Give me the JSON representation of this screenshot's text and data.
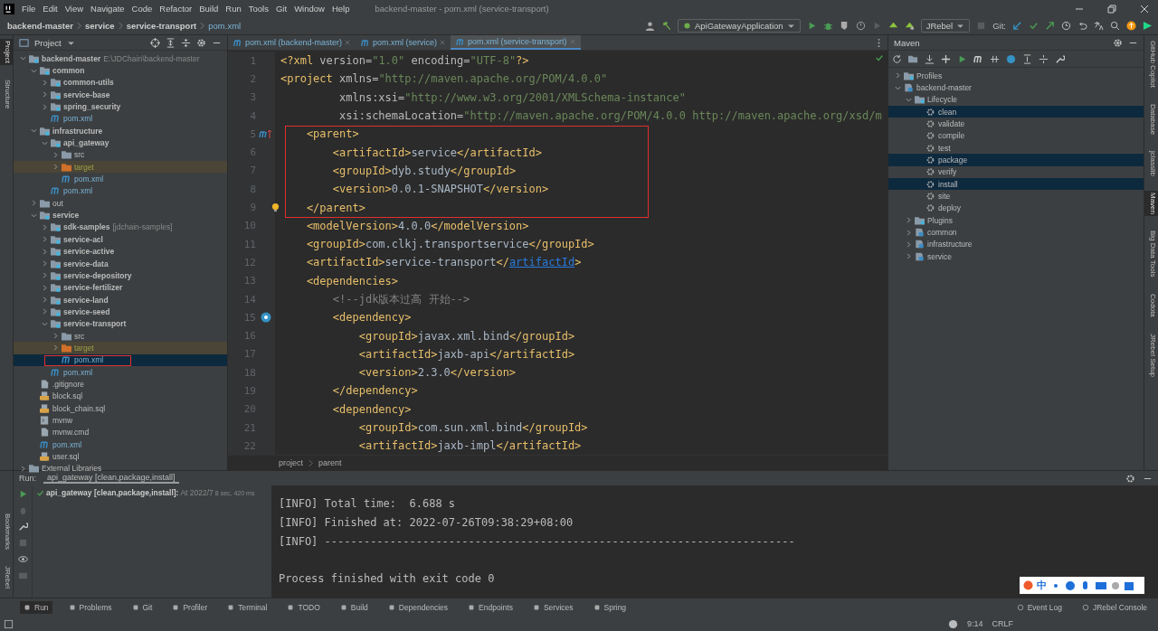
{
  "window": {
    "title": "backend-master - pom.xml (service-transport)"
  },
  "menu": [
    "File",
    "Edit",
    "View",
    "Navigate",
    "Code",
    "Refactor",
    "Build",
    "Run",
    "Tools",
    "Git",
    "Window",
    "Help"
  ],
  "breadcrumbs": [
    "backend-master",
    "service",
    "service-transport",
    "pom.xml"
  ],
  "toolbar": {
    "run_config": "ApiGatewayApplication",
    "jrebel": "JRebel",
    "git_label": "Git:"
  },
  "left_strip": [
    {
      "label": "Project",
      "selected": true
    },
    {
      "label": "Structure",
      "selected": false
    }
  ],
  "left_strip_bottom": [
    {
      "label": "Bookmarks",
      "selected": false
    },
    {
      "label": "JRebel",
      "selected": false
    }
  ],
  "right_strip": [
    {
      "label": "GitHub Copilot",
      "selected": false
    },
    {
      "label": "Database",
      "selected": false
    },
    {
      "label": "jclasslib",
      "selected": false
    },
    {
      "label": "Maven",
      "selected": true
    },
    {
      "label": "Big Data Tools",
      "selected": false
    },
    {
      "label": "Codota",
      "selected": false
    },
    {
      "label": "JRebel Setup",
      "selected": false
    }
  ],
  "project": {
    "title": "Project",
    "tree": [
      {
        "label": "backend-master",
        "note": "E:\\JDChain\\backend-master",
        "kind": "module",
        "expanded": true,
        "selected": false,
        "children": [
          {
            "label": "common",
            "kind": "module",
            "expanded": true,
            "selected": false,
            "children": [
              {
                "label": "common-utils",
                "kind": "module",
                "expanded": false,
                "selected": false
              },
              {
                "label": "service-base",
                "kind": "module",
                "expanded": false,
                "selected": false
              },
              {
                "label": "spring_security",
                "kind": "module",
                "expanded": false,
                "selected": false
              },
              {
                "label": "pom.xml",
                "kind": "maven",
                "selected": false
              }
            ]
          },
          {
            "label": "infrastructure",
            "kind": "module",
            "expanded": true,
            "selected": false,
            "children": [
              {
                "label": "api_gateway",
                "kind": "module",
                "expanded": true,
                "selected": false,
                "children": [
                  {
                    "label": "src",
                    "kind": "folder",
                    "expanded": false,
                    "selected": false
                  },
                  {
                    "label": "target",
                    "kind": "target",
                    "expanded": false,
                    "selected": false
                  },
                  {
                    "label": "pom.xml",
                    "kind": "maven",
                    "selected": false
                  }
                ]
              },
              {
                "label": "pom.xml",
                "kind": "maven",
                "selected": false
              }
            ]
          },
          {
            "label": "out",
            "kind": "folder",
            "expanded": false,
            "selected": false
          },
          {
            "label": "service",
            "kind": "module",
            "expanded": true,
            "selected": false,
            "children": [
              {
                "label": "sdk-samples",
                "note": "[jdchain-samples]",
                "kind": "module",
                "expanded": false,
                "selected": false
              },
              {
                "label": "service-acl",
                "kind": "module",
                "expanded": false,
                "selected": false
              },
              {
                "label": "service-active",
                "kind": "module",
                "expanded": false,
                "selected": false
              },
              {
                "label": "service-data",
                "kind": "module",
                "expanded": false,
                "selected": false
              },
              {
                "label": "service-depository",
                "kind": "module",
                "expanded": false,
                "selected": false
              },
              {
                "label": "service-fertilizer",
                "kind": "module",
                "expanded": false,
                "selected": false
              },
              {
                "label": "service-land",
                "kind": "module",
                "expanded": false,
                "selected": false
              },
              {
                "label": "service-seed",
                "kind": "module",
                "expanded": false,
                "selected": false
              },
              {
                "label": "service-transport",
                "kind": "module",
                "expanded": true,
                "selected": false,
                "children": [
                  {
                    "label": "src",
                    "kind": "folder",
                    "expanded": false,
                    "selected": false
                  },
                  {
                    "label": "target",
                    "kind": "target",
                    "expanded": false,
                    "selected": false
                  },
                  {
                    "label": "pom.xml",
                    "kind": "maven",
                    "selected": true
                  }
                ]
              },
              {
                "label": "pom.xml",
                "kind": "maven",
                "selected": false
              }
            ]
          },
          {
            "label": ".gitignore",
            "kind": "file",
            "selected": false
          },
          {
            "label": "block.sql",
            "kind": "sql",
            "selected": false
          },
          {
            "label": "block_chain.sql",
            "kind": "sql",
            "selected": false
          },
          {
            "label": "mvnw",
            "kind": "script",
            "selected": false
          },
          {
            "label": "mvnw.cmd",
            "kind": "file",
            "selected": false
          },
          {
            "label": "pom.xml",
            "kind": "maven",
            "selected": false
          },
          {
            "label": "user.sql",
            "kind": "sql",
            "selected": false
          }
        ]
      },
      {
        "label": "External Libraries",
        "kind": "library",
        "expanded": false,
        "selected": false
      }
    ]
  },
  "editor": {
    "tabs": [
      {
        "label": "pom.xml (backend-master)",
        "selected": false
      },
      {
        "label": "pom.xml (service)",
        "selected": false
      },
      {
        "label": "pom.xml (service-transport)",
        "selected": true
      }
    ],
    "lines": [
      {
        "number": "1",
        "tokens": [
          {
            "kind": "tag",
            "text": "<?xml "
          },
          {
            "kind": "attr",
            "text": "version="
          },
          {
            "kind": "str",
            "text": "\"1.0\""
          },
          {
            "kind": "attr",
            "text": " encoding="
          },
          {
            "kind": "str",
            "text": "\"UTF-8\""
          },
          {
            "kind": "tag",
            "text": "?>"
          }
        ]
      },
      {
        "number": "2",
        "tokens": [
          {
            "kind": "tag",
            "text": "<project "
          },
          {
            "kind": "attr",
            "text": "xmlns="
          },
          {
            "kind": "str",
            "text": "\"http://maven.apache.org/POM/4.0.0\""
          }
        ]
      },
      {
        "number": "3",
        "tokens": [
          {
            "kind": "attr",
            "text": "         xmlns:xsi="
          },
          {
            "kind": "str",
            "text": "\"http://www.w3.org/2001/XMLSchema-instance\""
          }
        ]
      },
      {
        "number": "4",
        "tokens": [
          {
            "kind": "attr",
            "text": "         xsi:schemaLocation="
          },
          {
            "kind": "str",
            "text": "\"http://maven.apache.org/POM/4.0.0 http://maven.apache.org/xsd/m"
          }
        ]
      },
      {
        "number": "5",
        "kind": "override",
        "match": true,
        "tokens": [
          {
            "kind": "tag",
            "text": "    <parent>"
          }
        ]
      },
      {
        "number": "6",
        "tokens": [
          {
            "kind": "tag",
            "text": "        <artifactId>"
          },
          {
            "kind": "text",
            "text": "service"
          },
          {
            "kind": "tag",
            "text": "</artifactId>"
          }
        ]
      },
      {
        "number": "7",
        "tokens": [
          {
            "kind": "tag",
            "text": "        <groupId>"
          },
          {
            "kind": "text",
            "text": "dyb.study"
          },
          {
            "kind": "tag",
            "text": "</groupId>"
          }
        ]
      },
      {
        "number": "8",
        "tokens": [
          {
            "kind": "tag",
            "text": "        <version>"
          },
          {
            "kind": "text",
            "text": "0.0.1-SNAPSHOT"
          },
          {
            "kind": "tag",
            "text": "</version>"
          }
        ]
      },
      {
        "number": "9",
        "kind": "bulb",
        "match": true,
        "tokens": [
          {
            "kind": "tag",
            "text": "    </parent>"
          }
        ]
      },
      {
        "number": "10",
        "tokens": [
          {
            "kind": "tag",
            "text": "    <modelVersion>"
          },
          {
            "kind": "text",
            "text": "4.0.0"
          },
          {
            "kind": "tag",
            "text": "</modelVersion>"
          }
        ]
      },
      {
        "number": "11",
        "tokens": [
          {
            "kind": "tag",
            "text": "    <groupId>"
          },
          {
            "kind": "text",
            "text": "com.clkj.transportservice"
          },
          {
            "kind": "tag",
            "text": "</groupId>"
          }
        ]
      },
      {
        "number": "12",
        "tokens": [
          {
            "kind": "tag",
            "text": "    <artifactId>"
          },
          {
            "kind": "text",
            "text": "service-transport"
          },
          {
            "kind": "tag",
            "text": "</"
          },
          {
            "kind": "link",
            "text": "artifactId"
          },
          {
            "kind": "tag",
            "text": ">"
          }
        ]
      },
      {
        "number": "13",
        "tokens": [
          {
            "kind": "tag",
            "text": "    <dependencies>"
          }
        ]
      },
      {
        "number": "14",
        "tokens": [
          {
            "kind": "comment",
            "text": "        <!--jdk版本过高 开始-->"
          }
        ]
      },
      {
        "number": "15",
        "kind": "dependency",
        "tokens": [
          {
            "kind": "tag",
            "text": "        <dependency>"
          }
        ]
      },
      {
        "number": "16",
        "tokens": [
          {
            "kind": "tag",
            "text": "            <groupId>"
          },
          {
            "kind": "text",
            "text": "javax.xml.bind"
          },
          {
            "kind": "tag",
            "text": "</groupId>"
          }
        ]
      },
      {
        "number": "17",
        "tokens": [
          {
            "kind": "tag",
            "text": "            <artifactId>"
          },
          {
            "kind": "text",
            "text": "jaxb-api"
          },
          {
            "kind": "tag",
            "text": "</artifactId>"
          }
        ]
      },
      {
        "number": "18",
        "tokens": [
          {
            "kind": "tag",
            "text": "            <version>"
          },
          {
            "kind": "text",
            "text": "2.3.0"
          },
          {
            "kind": "tag",
            "text": "</version>"
          }
        ]
      },
      {
        "number": "19",
        "tokens": [
          {
            "kind": "tag",
            "text": "        </dependency>"
          }
        ]
      },
      {
        "number": "20",
        "tokens": [
          {
            "kind": "tag",
            "text": "        <dependency>"
          }
        ]
      },
      {
        "number": "21",
        "tokens": [
          {
            "kind": "tag",
            "text": "            <groupId>"
          },
          {
            "kind": "text",
            "text": "com.sun.xml.bind"
          },
          {
            "kind": "tag",
            "text": "</groupId>"
          }
        ]
      },
      {
        "number": "22",
        "tokens": [
          {
            "kind": "tag",
            "text": "            <artifactId>"
          },
          {
            "kind": "text",
            "text": "jaxb-impl"
          },
          {
            "kind": "tag",
            "text": "</artifactId>"
          }
        ]
      }
    ],
    "path": [
      "project",
      "parent"
    ]
  },
  "maven": {
    "title": "Maven",
    "tree": [
      {
        "label": "Profiles",
        "kind": "profiles",
        "expanded": false,
        "selected": false
      },
      {
        "label": "backend-master",
        "kind": "project",
        "expanded": true,
        "selected": false,
        "children": [
          {
            "label": "Lifecycle",
            "kind": "lifecycle",
            "expanded": true,
            "selected": false,
            "children": [
              {
                "label": "clean",
                "kind": "goal",
                "selected": true
              },
              {
                "label": "validate",
                "kind": "goal",
                "selected": false
              },
              {
                "label": "compile",
                "kind": "goal",
                "selected": false
              },
              {
                "label": "test",
                "kind": "goal",
                "selected": false
              },
              {
                "label": "package",
                "kind": "goal",
                "selected": true
              },
              {
                "label": "verify",
                "kind": "goal",
                "selected": false
              },
              {
                "label": "install",
                "kind": "goal",
                "selected": true
              },
              {
                "label": "site",
                "kind": "goal",
                "selected": false
              },
              {
                "label": "deploy",
                "kind": "goal",
                "selected": false
              }
            ]
          },
          {
            "label": "Plugins",
            "kind": "lifecycle",
            "expanded": false,
            "selected": false
          },
          {
            "label": "common",
            "kind": "project",
            "expanded": false,
            "selected": false
          },
          {
            "label": "infrastructure",
            "kind": "project",
            "expanded": false,
            "selected": false
          },
          {
            "label": "service",
            "kind": "project",
            "expanded": false,
            "selected": false
          }
        ]
      }
    ]
  },
  "run": {
    "label": "Run:",
    "tab": "api_gateway [clean,package,install]",
    "entry": {
      "name": "api_gateway [clean,package,install]:",
      "time": "At 2022/7",
      "duration": "8 sec, 420 ms"
    },
    "output": [
      {
        "kind": "log",
        "text": "[INFO] Total time:  6.688 s"
      },
      {
        "kind": "log",
        "text": "[INFO] Finished at: 2022-07-26T09:38:29+08:00"
      },
      {
        "kind": "log",
        "text": "[INFO] ------------------------------------------------------------------------"
      },
      {
        "kind": "summary",
        "text": "Process finished with exit code 0"
      }
    ]
  },
  "ime": {
    "mode": "中"
  },
  "tool_windows": [
    {
      "label": "Run",
      "selected": true
    },
    {
      "label": "Problems",
      "selected": false
    },
    {
      "label": "Git",
      "selected": false
    },
    {
      "label": "Profiler",
      "selected": false
    },
    {
      "label": "Terminal",
      "selected": false
    },
    {
      "label": "TODO",
      "selected": false
    },
    {
      "label": "Build",
      "selected": false
    },
    {
      "label": "Dependencies",
      "selected": false
    },
    {
      "label": "Endpoints",
      "selected": false
    },
    {
      "label": "Services",
      "selected": false
    },
    {
      "label": "Spring",
      "selected": false
    }
  ],
  "tool_windows_right": [
    "Event Log",
    "JRebel Console"
  ],
  "status_bar": {
    "position": "9:14",
    "line_ending": "CRLF"
  }
}
